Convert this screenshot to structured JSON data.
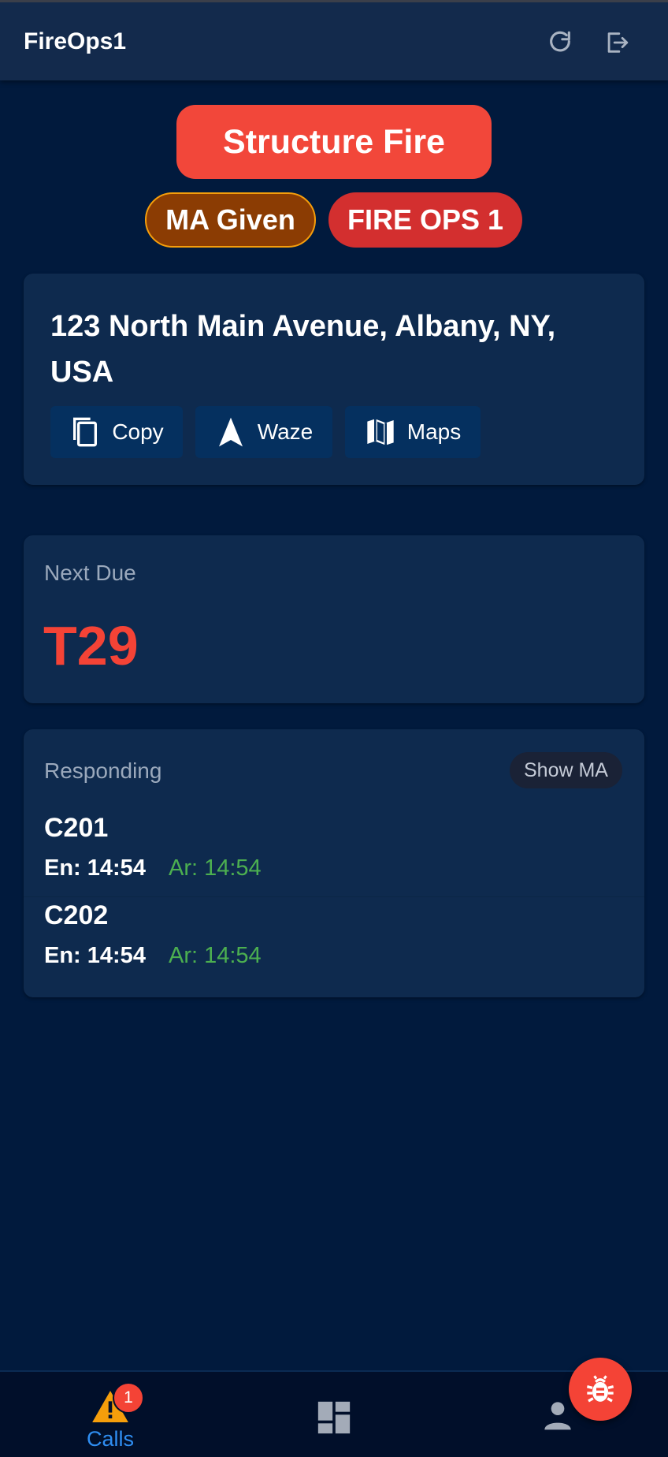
{
  "header": {
    "title": "FireOps1",
    "refresh_icon": "refresh-icon",
    "logout_icon": "logout-icon"
  },
  "call": {
    "type": "Structure Fire",
    "badges": [
      "MA Given",
      "FIRE OPS 1"
    ],
    "address": "123 North Main Avenue, Albany, NY, USA",
    "actions": [
      {
        "label": "Copy",
        "icon": "copy-icon"
      },
      {
        "label": "Waze",
        "icon": "navigation-arrow-icon"
      },
      {
        "label": "Maps",
        "icon": "map-icon"
      }
    ]
  },
  "next_due": {
    "label": "Next Due",
    "unit": "T29"
  },
  "responding": {
    "label": "Responding",
    "toggle_label": "Show MA",
    "units": [
      {
        "name": "C201",
        "en": "En: 14:54",
        "ar": "Ar: 14:54"
      },
      {
        "name": "C202",
        "en": "En: 14:54",
        "ar": "Ar: 14:54"
      }
    ]
  },
  "bottom_nav": {
    "calls_label": "Calls",
    "calls_count": "1",
    "items": [
      "warning-icon",
      "dashboard-icon",
      "profile-icon"
    ]
  },
  "fab": {
    "icon": "bug-icon"
  },
  "colors": {
    "background": "#011a3d",
    "card": "#0e2a4e",
    "accent_red": "#f44336",
    "ma_badge": "#8b3c03",
    "arrived_green": "#4caf50",
    "nav_active": "#2f8ef2"
  }
}
